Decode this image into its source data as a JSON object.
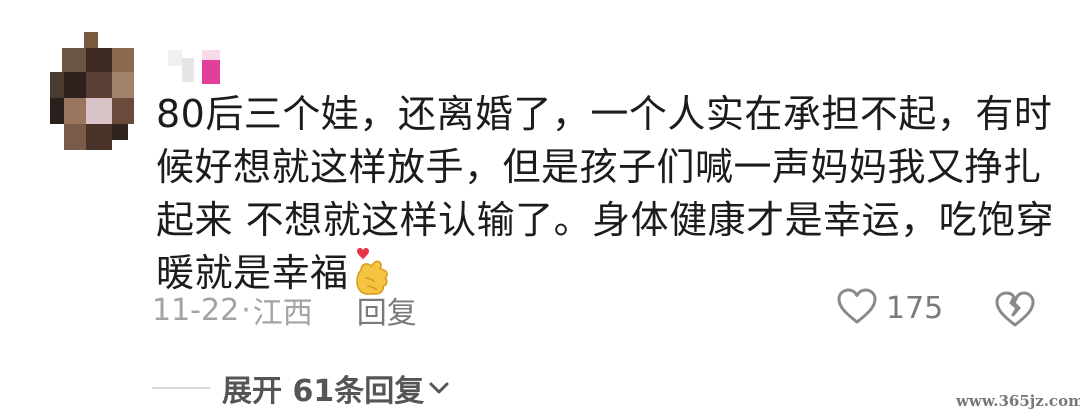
{
  "comment": {
    "lines": [
      "80后三个娃，还离婚了，一个人实在承担不起，有时",
      "候好想就这样放手，但是孩子们喊一声妈妈我又挣扎",
      "起来 不想就这样认输了。身体健康才是幸运，吃饱穿",
      "暖就是幸福"
    ],
    "emoji": "finger-heart-emoji",
    "date": "11-22",
    "separator": "·",
    "location": "江西",
    "reply_label": "回复",
    "like_count": "175"
  },
  "expand": {
    "label": "展开 61条回复"
  },
  "watermark": {
    "text": "www.365jz.com"
  },
  "icons": {
    "like": "heart-outline-icon",
    "dislike": "broken-heart-icon",
    "expand": "chevron-down-icon"
  },
  "colors": {
    "text": "#1c1c1c",
    "meta": "#a3a3a3",
    "action": "#7a7a7a",
    "emoji": "#f5c542"
  }
}
